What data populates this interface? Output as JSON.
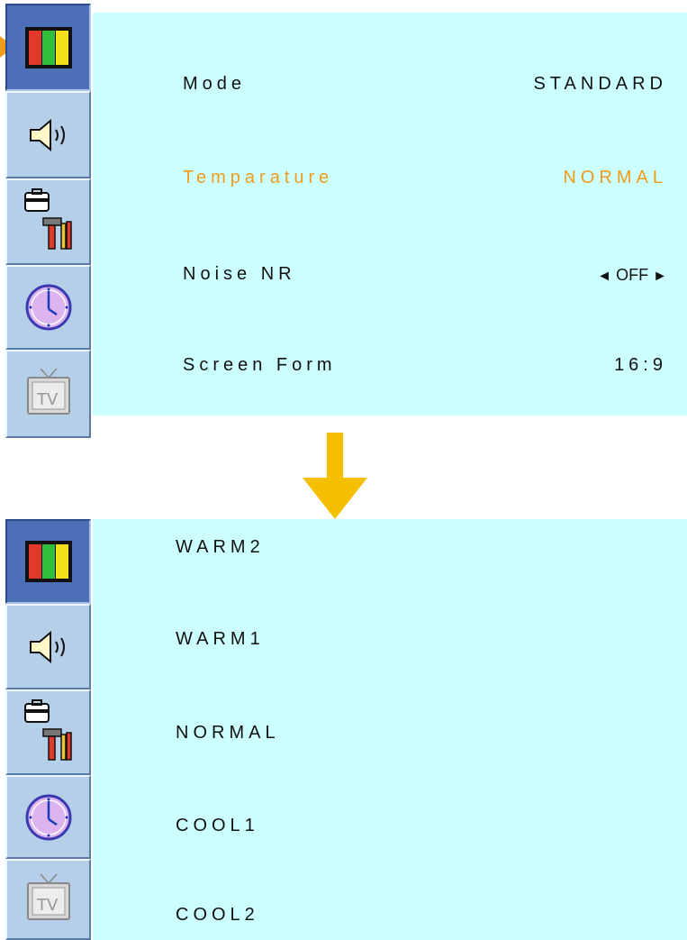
{
  "settings_menu": {
    "rows": [
      {
        "label": "Mode",
        "value": "STANDARD"
      },
      {
        "label": "Temparature",
        "value": "NORMAL"
      },
      {
        "label": "Noise NR",
        "value": "OFF",
        "prev": "◄",
        "next": "►"
      },
      {
        "label": "Screen Form",
        "value": "16:9"
      }
    ],
    "highlighted_row": "Temparature",
    "highlight_color": "#f29a1a",
    "panel_color": "#ccffff"
  },
  "sidebar_icons": [
    "picture-icon",
    "sound-icon",
    "tools-icon",
    "clock-icon",
    "tv-icon"
  ],
  "temperature_options": [
    "WARM2",
    "WARM1",
    "NORMAL",
    "COOL1",
    "COOL2"
  ],
  "arrow_color": "#f5c000"
}
